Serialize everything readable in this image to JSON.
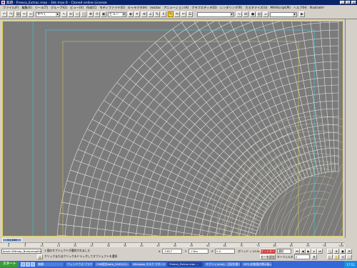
{
  "window": {
    "title": "無題 - Freeca_Extrac.max - 3ds max 6 - Cloned online License"
  },
  "menu": [
    {
      "label": "ファイル(F)"
    },
    {
      "label": "編集(E)"
    },
    {
      "label": "ツール(T)"
    },
    {
      "label": "グループ(G)"
    },
    {
      "label": "ビュー(V)"
    },
    {
      "label": "作成(C)"
    },
    {
      "label": "モディファイヤ(O)"
    },
    {
      "label": "キャラクタ(H)"
    },
    {
      "label": "reactor"
    },
    {
      "label": "アニメーション(A)"
    },
    {
      "label": "グラフエディタ(D)"
    },
    {
      "label": "レンダリング(R)"
    },
    {
      "label": "カスタマイズ(U)"
    },
    {
      "label": "MAXScript(M)"
    },
    {
      "label": "ヘルプ(H)"
    },
    {
      "label": "Illustrate!"
    }
  ],
  "toolbar": {
    "selection_filter": "すべて",
    "view_coord": "ビュー",
    "named_selection": ""
  },
  "viewport": {
    "label": ""
  },
  "tabs": {
    "time_slider": "0 / 100"
  },
  "ruler": {
    "ticks": [
      "0",
      "5",
      "10",
      "15",
      "20",
      "25",
      "30",
      "35",
      "40",
      "45",
      "50",
      "55",
      "60",
      "65",
      "70",
      "75",
      "80",
      "85",
      "90",
      "95",
      "100"
    ]
  },
  "status": {
    "listener": "$mat=Bitmap_Bumpmapfile:(1/cfl)",
    "prompt1": "1 個のオブジェクトが選択されました",
    "prompt2": "クリックまたはクリック＆ドラッグしてオブジェクトを選択",
    "x_label": "X",
    "x_value": "-3.827",
    "y_label": "Y",
    "y_value": "-7.6m",
    "z_label": "Z",
    "z_value": "0.0",
    "grid": "グリッド = 10.0cm",
    "auto_key": "オートキー",
    "set_key": "キーを設定",
    "key_filter": "キーフィルタ...",
    "selected": "選択",
    "frame": "0"
  },
  "taskbar": {
    "start": "スタート",
    "tasks": [
      {
        "label": "無題"
      },
      {
        "label": "ウィンドウズ ブラウザ"
      },
      {
        "label": "FHB設計data_2005111..."
      },
      {
        "label": "Windows タスク マネージャ"
      },
      {
        "label": "Freeca_Extrac.max ..."
      },
      {
        "label": "ミクシィ(mixi) - 日記を書く"
      },
      {
        "label": "MFC(お絵描き掲示板)..."
      }
    ],
    "clock": "17:51"
  }
}
